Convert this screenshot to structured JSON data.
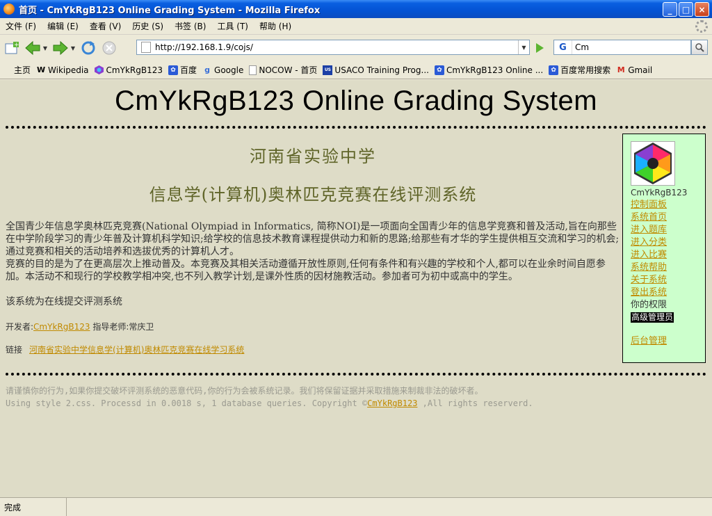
{
  "window": {
    "title": "首页 - CmYkRgB123 Online Grading System - Mozilla Firefox",
    "buttons": {
      "minimize": "_",
      "maximize": "□",
      "close": "×"
    }
  },
  "menu": {
    "items": [
      {
        "label": "文件 (F)"
      },
      {
        "label": "编辑 (E)"
      },
      {
        "label": "查看 (V)"
      },
      {
        "label": "历史 (S)"
      },
      {
        "label": "书签 (B)"
      },
      {
        "label": "工具 (T)"
      },
      {
        "label": "帮助 (H)"
      }
    ]
  },
  "nav": {
    "url": "http://192.168.1.9/cojs/",
    "search_engine": "G",
    "search_value": "Cm"
  },
  "bookmarks": [
    {
      "label": "主页",
      "icon": "none"
    },
    {
      "label": "Wikipedia",
      "icon": "W"
    },
    {
      "label": "CmYkRgB123",
      "icon": "hexagon-logo-icon"
    },
    {
      "label": "百度",
      "icon": "baidu-paw-icon"
    },
    {
      "label": "Google",
      "icon": "google-icon"
    },
    {
      "label": "NOCOW - 首页",
      "icon": "page-icon"
    },
    {
      "label": "USACO Training Prog...",
      "icon": "usaco-icon"
    },
    {
      "label": "CmYkRgB123 Online ...",
      "icon": "baidu-paw-icon"
    },
    {
      "label": "百度常用搜索",
      "icon": "baidu-paw-icon"
    },
    {
      "label": "Gmail",
      "icon": "gmail-icon"
    }
  ],
  "page": {
    "site_title": "CmYkRgB123 Online Grading System",
    "school": "河南省实验中学",
    "system_name": "信息学(计算机)奥林匹克竞赛在线评测系统",
    "intro_p1": "全国青少年信息学奥林匹克竞赛(National Olympiad in Informatics, 简称NOI)是一项面向全国青少年的信息学竞赛和普及活动,旨在向那些在中学阶段学习的青少年普及计算机科学知识;给学校的信息技术教育课程提供动力和新的思路;给那些有才华的学生提供相互交流和学习的机会;通过竞赛和相关的活动培养和选拔优秀的计算机人才。",
    "intro_p2": "竞赛的目的是为了在更高层次上推动普及。本竞赛及其相关活动遵循开放性原则,任何有条件和有兴趣的学校和个人,都可以在业余时间自愿参加。本活动不和现行的学校教学相冲突,也不列入教学计划,是课外性质的因材施教活动。参加者可为初中或高中的学生。",
    "online_note": "该系统为在线提交评测系统",
    "developer_label": "开发者:",
    "developer_name": "CmYkRgB123",
    "advisor": "指导老师:常庆卫",
    "links_label": "链接",
    "links_item": "河南省实验中学信息学(计算机)奥林匹克竞赛在线学习系统"
  },
  "sidebar": {
    "username": "CmYkRgB123",
    "links": [
      {
        "label": "控制面板"
      },
      {
        "label": "系统首页"
      },
      {
        "label": "进入题库"
      },
      {
        "label": "进入分类"
      },
      {
        "label": "进入比赛"
      },
      {
        "label": "系统帮助"
      },
      {
        "label": "关于系统"
      },
      {
        "label": "登出系统"
      }
    ],
    "permission_label": "你的权限",
    "permission_value": "高级管理员",
    "admin_link": "后台管理"
  },
  "footer": {
    "warning": "请谨慎你的行为,如果你提交破坏评测系统的恶意代码,你的行为会被系统记录。我们将保留证据并采取措施来制裁非法的破坏者。",
    "stats_prefix": "Using style 2.css. Processd in 0.0018 s, 1 database queries. Copyright ©",
    "copyright_name": "CmYkRgB123",
    "stats_suffix": " ,All rights reserverd."
  },
  "status": {
    "text": "完成"
  },
  "colors": {
    "content_bg": "#dedcc7",
    "heading": "#5f6428",
    "link": "#c08a00",
    "sidebar_bg": "#ccffcc"
  }
}
